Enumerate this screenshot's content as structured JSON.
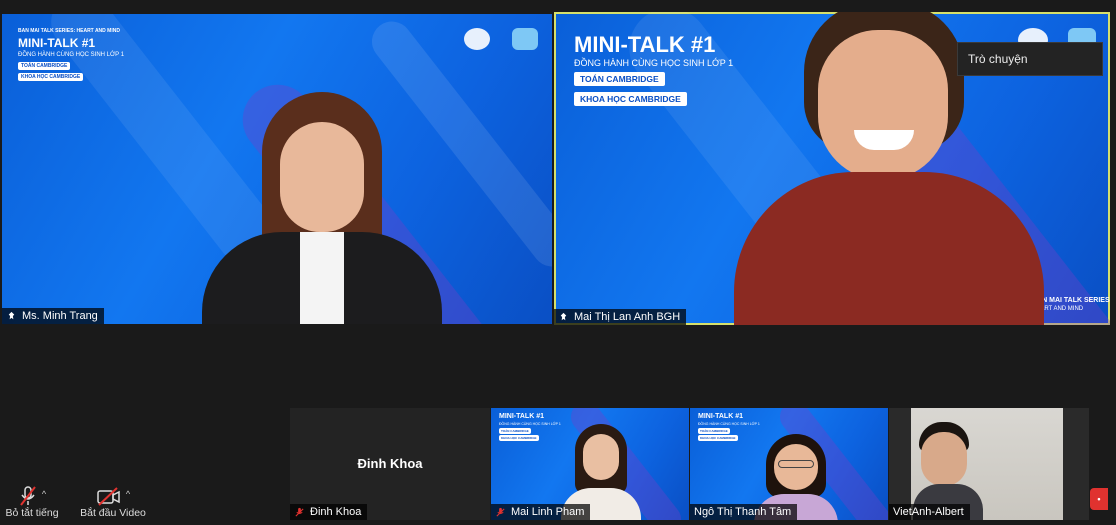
{
  "chat_button": {
    "label": "Trò chuyện"
  },
  "main_tiles": [
    {
      "name": "Ms. Minh Trang"
    },
    {
      "name": "Mai Thị Lan Anh BGH"
    }
  ],
  "banner": {
    "series": "BAN MAI TALK SERIES: HEART AND MIND",
    "title": "MINI-TALK #1",
    "subtitle": "ĐỒNG HÀNH CÙNG HỌC SINH LỚP 1",
    "pill1": "TOÁN CAMBRIDGE",
    "pill2": "KHOA HỌC CAMBRIDGE",
    "corner": "BAN MAI TALK SERIES",
    "corner2": "HEART AND MIND"
  },
  "gallery": [
    {
      "name": "Đinh Khoa",
      "center_label": "Đinh Khoa"
    },
    {
      "name": "Mai Linh Pham"
    },
    {
      "name": "Ngô Thị Thanh Tâm"
    },
    {
      "name": "VietAnh-Albert"
    }
  ],
  "controls": {
    "mute_label": "Bỏ tắt tiếng",
    "video_label": "Bắt đầu Video"
  },
  "colors": {
    "accent_border": "#d6e06b",
    "muted_red": "#e0322f",
    "banner_blue": "#1277f0"
  }
}
